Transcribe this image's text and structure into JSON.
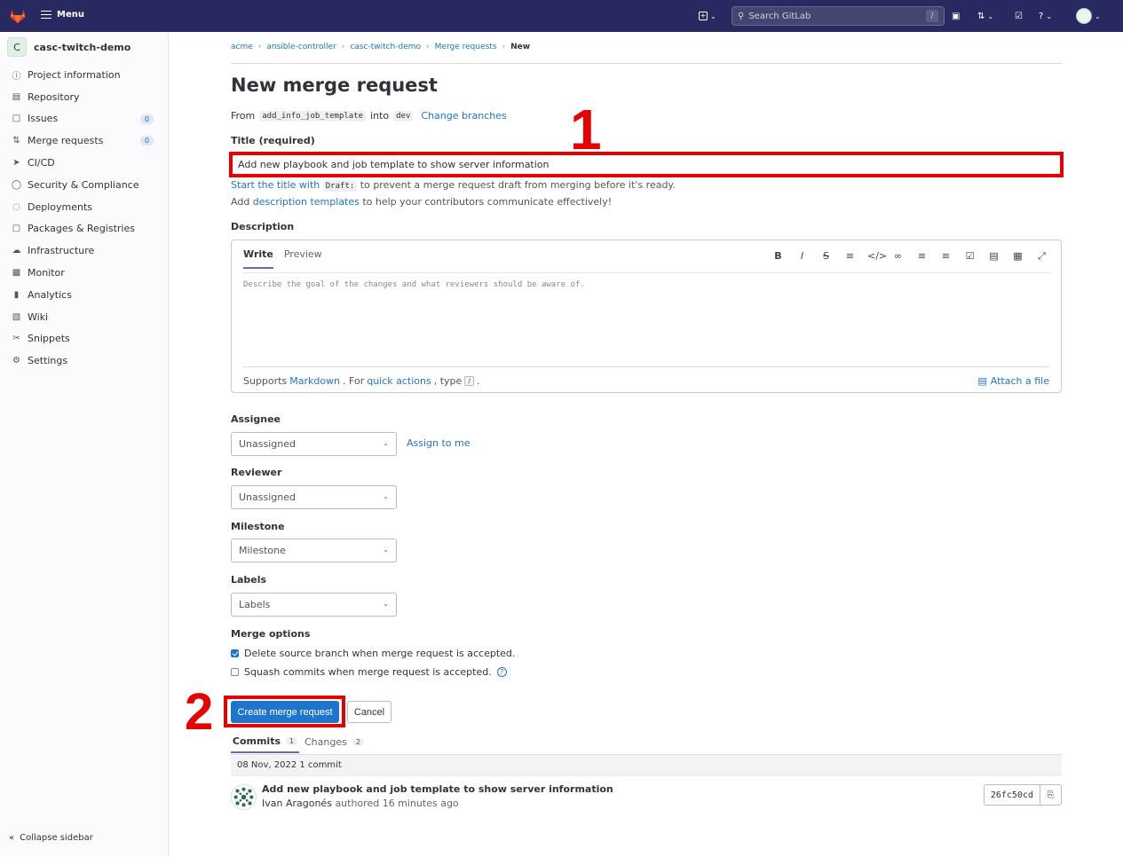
{
  "topbar": {
    "menu_label": "Menu",
    "search_placeholder": "Search GitLab",
    "search_shortcut": "/"
  },
  "sidebar": {
    "project_initial": "C",
    "project_name": "casc-twitch-demo",
    "items": [
      {
        "label": "Project information",
        "icon": "info-icon"
      },
      {
        "label": "Repository",
        "icon": "doc-icon"
      },
      {
        "label": "Issues",
        "icon": "issues-icon",
        "count": "0"
      },
      {
        "label": "Merge requests",
        "icon": "merge-request-icon",
        "count": "0"
      },
      {
        "label": "CI/CD",
        "icon": "rocket-icon"
      },
      {
        "label": "Security & Compliance",
        "icon": "shield-icon"
      },
      {
        "label": "Deployments",
        "icon": "deployments-icon"
      },
      {
        "label": "Packages & Registries",
        "icon": "package-icon"
      },
      {
        "label": "Infrastructure",
        "icon": "cloud-icon"
      },
      {
        "label": "Monitor",
        "icon": "monitor-icon"
      },
      {
        "label": "Analytics",
        "icon": "chart-icon"
      },
      {
        "label": "Wiki",
        "icon": "book-icon"
      },
      {
        "label": "Snippets",
        "icon": "scissors-icon"
      },
      {
        "label": "Settings",
        "icon": "gear-icon"
      }
    ],
    "collapse_label": "Collapse sidebar"
  },
  "breadcrumb": [
    "acme",
    "ansible-controller",
    "casc-twitch-demo",
    "Merge requests",
    "New"
  ],
  "page_title": "New merge request",
  "from_line": {
    "from_label": "From",
    "source_branch": "add_info_job_template",
    "into_label": "into",
    "target_branch": "dev",
    "change_link": "Change branches"
  },
  "title_field": {
    "label": "Title (required)",
    "value": "Add new playbook and job template to show server information",
    "hint_link": "Start the title with",
    "hint_code": "Draft:",
    "hint_rest": "to prevent a merge request draft from merging before it's ready.",
    "templates_prefix": "Add",
    "templates_link": "description templates",
    "templates_rest": "to help your contributors communicate effectively!"
  },
  "annotations": {
    "one": "1",
    "two": "2",
    "color": "#e60000"
  },
  "description": {
    "label": "Description",
    "tab_write": "Write",
    "tab_preview": "Preview",
    "placeholder": "Describe the goal of the changes and what reviewers should be aware of.",
    "footer_prefix": "Supports",
    "markdown_link": "Markdown",
    "footer_mid": ". For",
    "quick_actions_link": "quick actions",
    "footer_type": ", type",
    "slash_key": "/",
    "attach_label": "Attach a file"
  },
  "assignee": {
    "label": "Assignee",
    "value": "Unassigned",
    "assign_me": "Assign to me"
  },
  "reviewer": {
    "label": "Reviewer",
    "value": "Unassigned"
  },
  "milestone": {
    "label": "Milestone",
    "value": "Milestone"
  },
  "labels": {
    "label": "Labels",
    "value": "Labels"
  },
  "merge_options": {
    "label": "Merge options",
    "delete_source": "Delete source branch when merge request is accepted.",
    "delete_checked": true,
    "squash": "Squash commits when merge request is accepted.",
    "squash_checked": false
  },
  "actions": {
    "create": "Create merge request",
    "cancel": "Cancel"
  },
  "commit_tabs": {
    "commits_label": "Commits",
    "commits_count": "1",
    "changes_label": "Changes",
    "changes_count": "2"
  },
  "commit_list": {
    "day_header": "08 Nov, 2022 1 commit",
    "commits": [
      {
        "title": "Add new playbook and job template to show server information",
        "author": "Ivan Aragonés",
        "authored": "authored 16 minutes ago",
        "sha": "26fc50cd"
      }
    ]
  },
  "colors": {
    "accent": "#1f75cb",
    "topbar": "#292961",
    "annotation": "#e60000"
  }
}
